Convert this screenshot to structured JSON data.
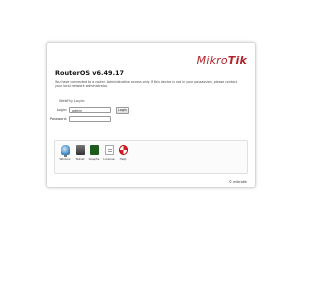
{
  "logo": {
    "part1": "Mikro",
    "part2": "Tik"
  },
  "title": "RouterOS v6.49.17",
  "description": "You have connected to a router. Administrative access only. If this device is not in your possession, please contact your local network administrator.",
  "login": {
    "heading": "WebFig Login:",
    "login_label": "Login:",
    "login_value": "admin",
    "password_label": "Password:",
    "password_value": "",
    "button_label": "Login"
  },
  "apps": [
    {
      "label": "Winbox",
      "icon": "winbox-icon"
    },
    {
      "label": "Telnet",
      "icon": "terminal-icon"
    },
    {
      "label": "Graphs",
      "icon": "graphs-icon"
    },
    {
      "label": "License",
      "icon": "license-document-icon"
    },
    {
      "label": "Help",
      "icon": "help-lifebuoy-icon"
    }
  ],
  "footer": {
    "link": "© mikrotik"
  },
  "colors": {
    "brand_red": "#b0242b"
  }
}
